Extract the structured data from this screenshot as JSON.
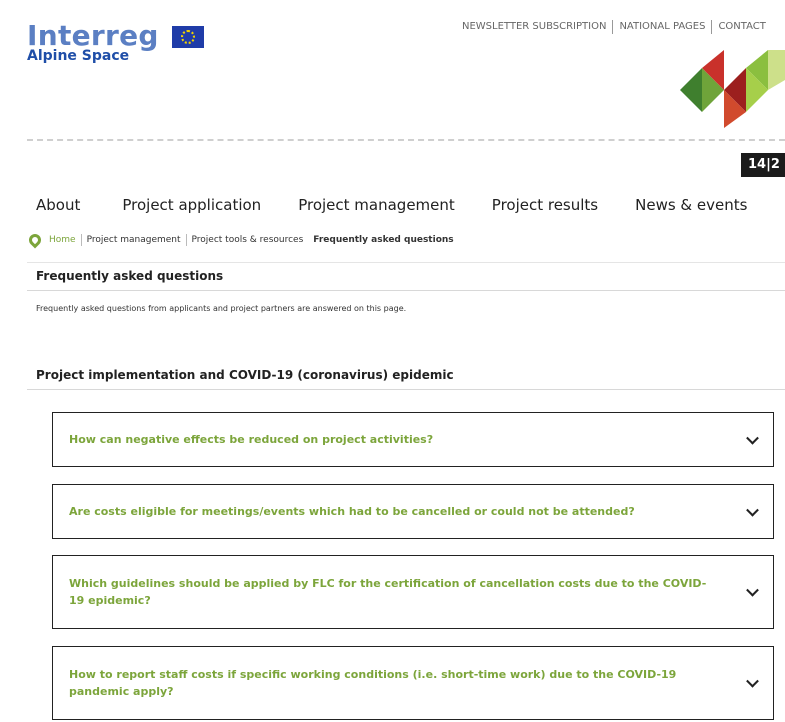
{
  "brand": {
    "name": "Interreg",
    "subtitle": "Alpine Space"
  },
  "top_nav": [
    "NEWSLETTER SUBSCRIPTION",
    "NATIONAL PAGES",
    "CONTACT"
  ],
  "badge": "14|2",
  "main_nav": [
    "About",
    "Project application",
    "Project management",
    "Project results",
    "News & events"
  ],
  "breadcrumb": [
    "Home",
    "Project management",
    "Project tools & resources",
    "Frequently asked questions"
  ],
  "page": {
    "title": "Frequently asked questions",
    "intro": "Frequently asked questions from applicants and project partners are answered on this page.",
    "section_title": "Project implementation and COVID-19 (coronavirus) epidemic"
  },
  "faqs": [
    "How can negative effects be reduced on project activities?",
    "Are costs eligible for meetings/events which had to be cancelled or could not be attended?",
    "Which guidelines should be applied by FLC for the certification of cancellation costs due to the COVID-19 epidemic?",
    "How to report staff costs if specific working conditions (i.e. short-time work) due to the COVID-19 pandemic apply?"
  ],
  "colors": {
    "brand_blue": "#5b7fc3",
    "accent_green": "#7ca53b",
    "eu_blue": "#1f3ca8"
  }
}
